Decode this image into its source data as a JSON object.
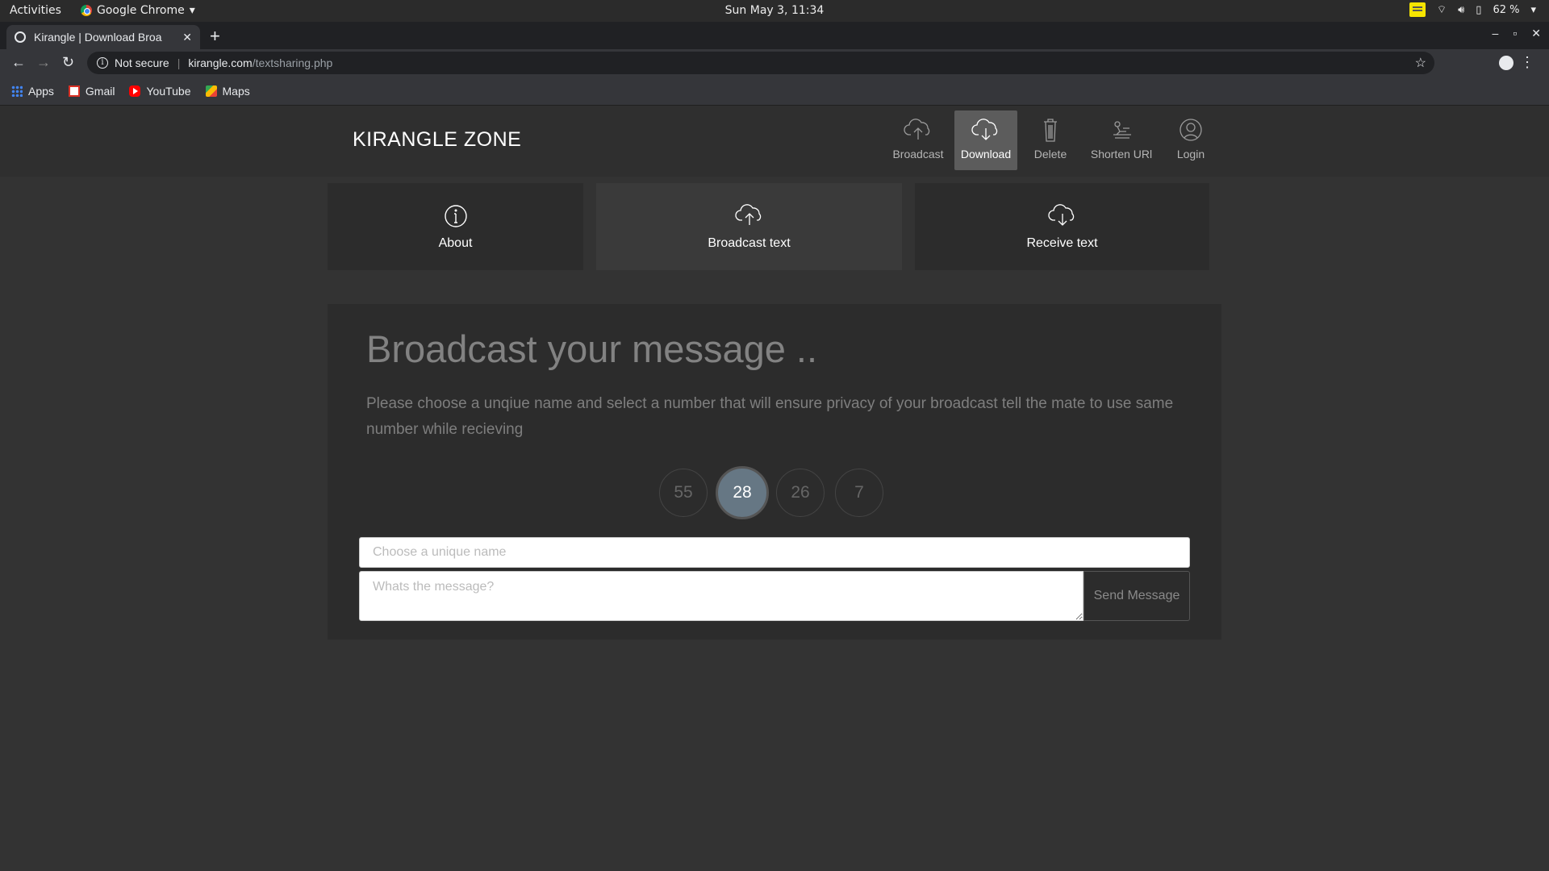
{
  "os": {
    "activities": "Activities",
    "app_name": "Google Chrome",
    "clock": "Sun May  3, 11:34",
    "battery": "62 %"
  },
  "browser": {
    "tab_title": "Kirangle | Download Broa",
    "security": "Not secure",
    "url_host": "kirangle.com",
    "url_path": "/textsharing.php",
    "bookmarks": [
      {
        "label": "Apps",
        "icon": "apps-grid-icon"
      },
      {
        "label": "Gmail",
        "icon": "gmail-icon"
      },
      {
        "label": "YouTube",
        "icon": "youtube-icon"
      },
      {
        "label": "Maps",
        "icon": "maps-icon"
      }
    ]
  },
  "site": {
    "brand": "KIRANGLE ZONE",
    "nav": [
      {
        "label": "Broadcast",
        "icon": "cloud-upload-icon"
      },
      {
        "label": "Download",
        "icon": "cloud-download-icon",
        "active": true
      },
      {
        "label": "Delete",
        "icon": "trash-icon"
      },
      {
        "label": "Shorten URl",
        "icon": "shorten-icon"
      },
      {
        "label": "Login",
        "icon": "user-icon"
      }
    ],
    "tiles": [
      {
        "label": "About",
        "icon": "info-icon"
      },
      {
        "label": "Broadcast text",
        "icon": "cloud-upload-icon",
        "active": true
      },
      {
        "label": "Receive text",
        "icon": "cloud-download-icon"
      }
    ]
  },
  "panel": {
    "title": "Broadcast your message ..",
    "description": "Please choose a unqiue name and select a number that will ensure privacy of your broadcast tell the mate to use same number while recieving",
    "numbers": [
      "55",
      "28",
      "26",
      "7"
    ],
    "selected_number": "28",
    "name_placeholder": "Choose a unique name",
    "message_placeholder": "Whats the message?",
    "send_label": "Send Message"
  },
  "colors": {
    "page_bg": "#333333",
    "header_bg": "#2f2f2f",
    "active_nav_bg": "#5c5c5c",
    "selected_number_bg": "#667784"
  }
}
